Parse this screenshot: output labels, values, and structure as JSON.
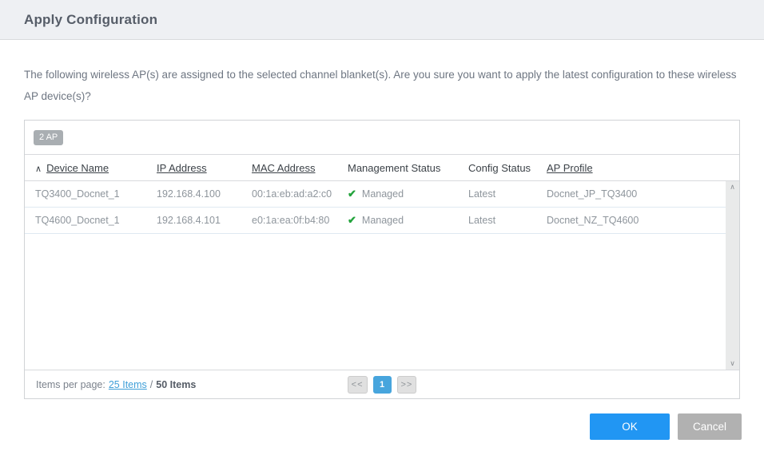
{
  "dialog": {
    "title": "Apply Configuration",
    "message": "The following wireless AP(s) are assigned to the selected channel blanket(s). Are you sure you want to apply the latest configuration to these wireless AP device(s)?"
  },
  "icons": {
    "sort_ascending": "∧",
    "managed_check": "✔",
    "scroll_up": "∧",
    "scroll_down": "∨"
  },
  "table": {
    "badge": "2 AP",
    "columns": [
      {
        "label": "Device Name"
      },
      {
        "label": "IP Address"
      },
      {
        "label": "MAC Address"
      },
      {
        "label": "Management Status"
      },
      {
        "label": "Config Status"
      },
      {
        "label": "AP Profile"
      }
    ],
    "rows": [
      {
        "device_name": "TQ3400_Docnet_1",
        "ip_address": "192.168.4.100",
        "mac_address": "00:1a:eb:ad:a2:c0",
        "management_status": "Managed",
        "config_status": "Latest",
        "ap_profile": "Docnet_JP_TQ3400"
      },
      {
        "device_name": "TQ4600_Docnet_1",
        "ip_address": "192.168.4.101",
        "mac_address": "e0:1a:ea:0f:b4:80",
        "management_status": "Managed",
        "config_status": "Latest",
        "ap_profile": "Docnet_NZ_TQ4600"
      }
    ],
    "pagination": {
      "items_per_page_label": "Items per page:",
      "items_per_page_value": "25 Items",
      "separator": "/",
      "total_items": "50 Items",
      "prev_label": "<<",
      "current_page": "1",
      "next_label": ">>"
    }
  },
  "footer": {
    "ok_label": "OK",
    "cancel_label": "Cancel"
  },
  "colors": {
    "accent_blue": "#2196f3",
    "pager_active_blue": "#47a5dd",
    "link_blue": "#3f9fd8",
    "check_green": "#23a33c",
    "cancel_gray": "#b1b1b1",
    "titlebar_bg": "#eef0f3"
  }
}
